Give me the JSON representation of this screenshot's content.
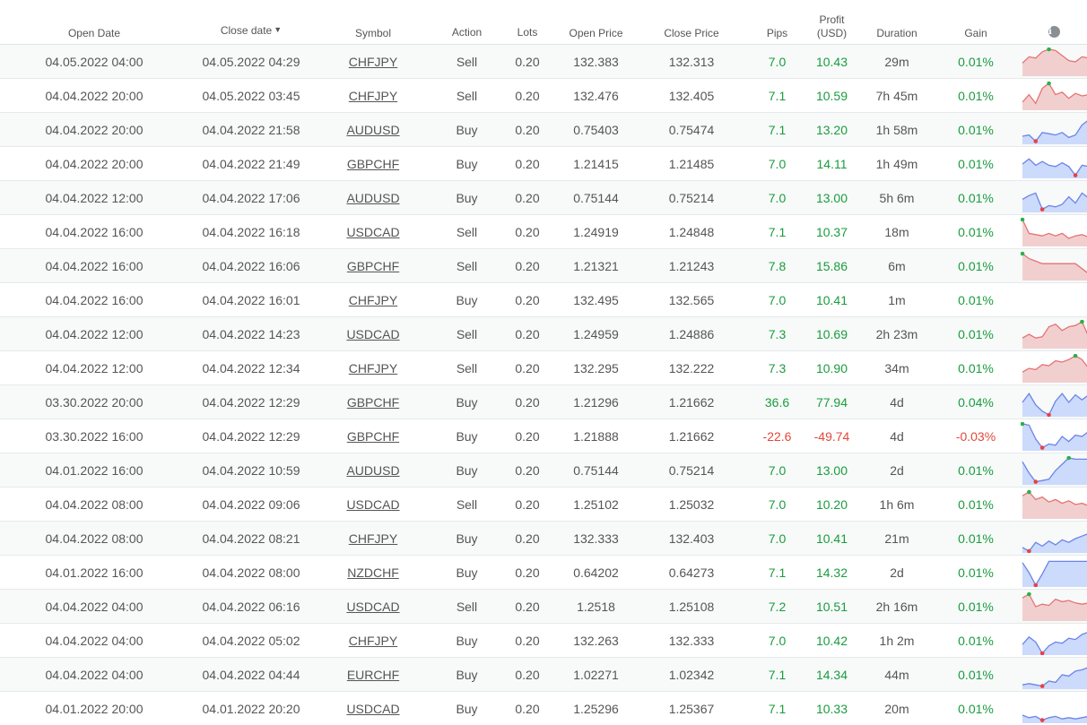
{
  "headers": {
    "open_date": "Open Date",
    "close_date": "Close date",
    "close_date_sort_indicator": "▼",
    "symbol": "Symbol",
    "action": "Action",
    "lots": "Lots",
    "open_price": "Open Price",
    "close_price": "Close Price",
    "pips": "Pips",
    "profit_line1": "Profit",
    "profit_line2": "(USD)",
    "duration": "Duration",
    "gain": "Gain",
    "info_icon": "info-icon"
  },
  "colors": {
    "positive": "#1a9c3e",
    "negative": "#e0483c",
    "sell_fill": "#f2cfcf",
    "sell_line": "#e57373",
    "buy_fill": "#ccdafc",
    "buy_line": "#6b84e8",
    "marker_high": "#2bb14a",
    "marker_low": "#ec4040"
  },
  "trades": [
    {
      "open_date": "04.05.2022 04:00",
      "close_date": "04.05.2022 04:29",
      "symbol": "CHFJPY",
      "action": "Sell",
      "lots": "0.20",
      "open_price": "132.383",
      "close_price": "132.313",
      "pips": "7.0",
      "profit": "10.43",
      "duration": "29m",
      "gain": "0.01%",
      "positive": true,
      "spark": [
        0.55,
        0.3,
        0.35,
        0.1,
        0.0,
        0.05,
        0.25,
        0.45,
        0.5,
        0.3,
        0.35,
        0.6,
        0.95,
        0.9
      ]
    },
    {
      "open_date": "04.04.2022 20:00",
      "close_date": "04.05.2022 03:45",
      "symbol": "CHFJPY",
      "action": "Sell",
      "lots": "0.20",
      "open_price": "132.476",
      "close_price": "132.405",
      "pips": "7.1",
      "profit": "10.59",
      "duration": "7h 45m",
      "gain": "0.01%",
      "positive": true,
      "spark": [
        0.75,
        0.45,
        0.8,
        0.2,
        0.0,
        0.45,
        0.35,
        0.6,
        0.4,
        0.5,
        0.45,
        0.5,
        0.95,
        0.75
      ]
    },
    {
      "open_date": "04.04.2022 20:00",
      "close_date": "04.04.2022 21:58",
      "symbol": "AUDUSD",
      "action": "Buy",
      "lots": "0.20",
      "open_price": "0.75403",
      "close_price": "0.75474",
      "pips": "7.1",
      "profit": "13.20",
      "duration": "1h 58m",
      "gain": "0.01%",
      "positive": true,
      "spark": [
        0.75,
        0.7,
        0.95,
        0.6,
        0.65,
        0.7,
        0.6,
        0.8,
        0.7,
        0.3,
        0.1,
        0.2,
        0.0,
        0.02
      ]
    },
    {
      "open_date": "04.04.2022 20:00",
      "close_date": "04.04.2022 21:49",
      "symbol": "GBPCHF",
      "action": "Buy",
      "lots": "0.20",
      "open_price": "1.21415",
      "close_price": "1.21485",
      "pips": "7.0",
      "profit": "14.11",
      "duration": "1h 49m",
      "gain": "0.01%",
      "positive": true,
      "spark": [
        0.5,
        0.3,
        0.55,
        0.4,
        0.55,
        0.6,
        0.45,
        0.6,
        0.95,
        0.55,
        0.6,
        0.2,
        0.1,
        0.0
      ]
    },
    {
      "open_date": "04.04.2022 12:00",
      "close_date": "04.04.2022 17:06",
      "symbol": "AUDUSD",
      "action": "Buy",
      "lots": "0.20",
      "open_price": "0.75144",
      "close_price": "0.75214",
      "pips": "7.0",
      "profit": "13.00",
      "duration": "5h 6m",
      "gain": "0.01%",
      "positive": true,
      "spark": [
        0.55,
        0.4,
        0.3,
        0.95,
        0.8,
        0.85,
        0.75,
        0.45,
        0.7,
        0.3,
        0.5,
        0.0,
        0.1,
        0.1
      ]
    },
    {
      "open_date": "04.04.2022 16:00",
      "close_date": "04.04.2022 16:18",
      "symbol": "USDCAD",
      "action": "Sell",
      "lots": "0.20",
      "open_price": "1.24919",
      "close_price": "1.24848",
      "pips": "7.1",
      "profit": "10.37",
      "duration": "18m",
      "gain": "0.01%",
      "positive": true,
      "spark": [
        0.0,
        0.55,
        0.6,
        0.65,
        0.55,
        0.65,
        0.55,
        0.75,
        0.65,
        0.6,
        0.7,
        0.75,
        0.95,
        0.85
      ]
    },
    {
      "open_date": "04.04.2022 16:00",
      "close_date": "04.04.2022 16:06",
      "symbol": "GBPCHF",
      "action": "Sell",
      "lots": "0.20",
      "open_price": "1.21321",
      "close_price": "1.21243",
      "pips": "7.8",
      "profit": "15.86",
      "duration": "6m",
      "gain": "0.01%",
      "positive": true,
      "spark": [
        0.0,
        0.2,
        0.3,
        0.4,
        0.4,
        0.4,
        0.4,
        0.4,
        0.4,
        0.6,
        0.8,
        0.95,
        0.85,
        0.65
      ]
    },
    {
      "open_date": "04.04.2022 16:00",
      "close_date": "04.04.2022 16:01",
      "symbol": "CHFJPY",
      "action": "Buy",
      "lots": "0.20",
      "open_price": "132.495",
      "close_price": "132.565",
      "pips": "7.0",
      "profit": "10.41",
      "duration": "1m",
      "gain": "0.01%",
      "positive": true,
      "spark": null
    },
    {
      "open_date": "04.04.2022 12:00",
      "close_date": "04.04.2022 14:23",
      "symbol": "USDCAD",
      "action": "Sell",
      "lots": "0.20",
      "open_price": "1.24959",
      "close_price": "1.24886",
      "pips": "7.3",
      "profit": "10.69",
      "duration": "2h 23m",
      "gain": "0.01%",
      "positive": true,
      "spark": [
        0.65,
        0.5,
        0.65,
        0.6,
        0.2,
        0.1,
        0.35,
        0.2,
        0.15,
        0.0,
        0.6,
        0.85,
        0.95,
        0.95
      ]
    },
    {
      "open_date": "04.04.2022 12:00",
      "close_date": "04.04.2022 12:34",
      "symbol": "CHFJPY",
      "action": "Sell",
      "lots": "0.20",
      "open_price": "132.295",
      "close_price": "132.222",
      "pips": "7.3",
      "profit": "10.90",
      "duration": "34m",
      "gain": "0.01%",
      "positive": true,
      "spark": [
        0.65,
        0.5,
        0.55,
        0.35,
        0.4,
        0.2,
        0.25,
        0.15,
        0.0,
        0.15,
        0.5,
        0.7,
        0.95,
        0.85
      ]
    },
    {
      "open_date": "03.30.2022 20:00",
      "close_date": "04.04.2022 12:29",
      "symbol": "GBPCHF",
      "action": "Buy",
      "lots": "0.20",
      "open_price": "1.21296",
      "close_price": "1.21662",
      "pips": "36.6",
      "profit": "77.94",
      "duration": "4d",
      "gain": "0.04%",
      "positive": true,
      "spark": [
        0.5,
        0.15,
        0.6,
        0.85,
        1.0,
        0.45,
        0.15,
        0.5,
        0.2,
        0.4,
        0.2,
        0.25,
        0.2,
        0.0
      ]
    },
    {
      "open_date": "03.30.2022 16:00",
      "close_date": "04.04.2022 12:29",
      "symbol": "GBPCHF",
      "action": "Buy",
      "lots": "0.20",
      "open_price": "1.21888",
      "close_price": "1.21662",
      "pips": "-22.6",
      "profit": "-49.74",
      "duration": "4d",
      "gain": "-0.03%",
      "positive": false,
      "spark": [
        0.0,
        0.05,
        0.6,
        0.95,
        0.8,
        0.85,
        0.5,
        0.7,
        0.45,
        0.5,
        0.3,
        0.35,
        0.35,
        0.3
      ]
    },
    {
      "open_date": "04.01.2022 16:00",
      "close_date": "04.04.2022 10:59",
      "symbol": "AUDUSD",
      "action": "Buy",
      "lots": "0.20",
      "open_price": "0.75144",
      "close_price": "0.75214",
      "pips": "7.0",
      "profit": "13.00",
      "duration": "2d",
      "gain": "0.01%",
      "positive": true,
      "spark": [
        0.15,
        0.6,
        0.95,
        0.9,
        0.85,
        0.5,
        0.25,
        0.0,
        0.05,
        0.05,
        0.05,
        0.0,
        0.0,
        0.0
      ]
    },
    {
      "open_date": "04.04.2022 08:00",
      "close_date": "04.04.2022 09:06",
      "symbol": "USDCAD",
      "action": "Sell",
      "lots": "0.20",
      "open_price": "1.25102",
      "close_price": "1.25032",
      "pips": "7.0",
      "profit": "10.20",
      "duration": "1h 6m",
      "gain": "0.01%",
      "positive": true,
      "spark": [
        0.15,
        0.0,
        0.3,
        0.2,
        0.4,
        0.3,
        0.45,
        0.35,
        0.5,
        0.45,
        0.55,
        0.5,
        0.95,
        0.95
      ]
    },
    {
      "open_date": "04.04.2022 08:00",
      "close_date": "04.04.2022 08:21",
      "symbol": "CHFJPY",
      "action": "Buy",
      "lots": "0.20",
      "open_price": "132.333",
      "close_price": "132.403",
      "pips": "7.0",
      "profit": "10.41",
      "duration": "21m",
      "gain": "0.01%",
      "positive": true,
      "spark": [
        0.85,
        1.0,
        0.65,
        0.8,
        0.6,
        0.75,
        0.55,
        0.65,
        0.5,
        0.4,
        0.3,
        0.2,
        0.1,
        0.0
      ]
    },
    {
      "open_date": "04.01.2022 16:00",
      "close_date": "04.04.2022 08:00",
      "symbol": "NZDCHF",
      "action": "Buy",
      "lots": "0.20",
      "open_price": "0.64202",
      "close_price": "0.64273",
      "pips": "7.1",
      "profit": "14.32",
      "duration": "2d",
      "gain": "0.01%",
      "positive": true,
      "spark": [
        0.1,
        0.5,
        1.0,
        0.55,
        0.05,
        0.05,
        0.05,
        0.05,
        0.05,
        0.05,
        0.05,
        0.0,
        0.0,
        0.0
      ]
    },
    {
      "open_date": "04.04.2022 04:00",
      "close_date": "04.04.2022 06:16",
      "symbol": "USDCAD",
      "action": "Sell",
      "lots": "0.20",
      "open_price": "1.2518",
      "close_price": "1.25108",
      "pips": "7.2",
      "profit": "10.51",
      "duration": "2h 16m",
      "gain": "0.01%",
      "positive": true,
      "spark": [
        0.15,
        0.0,
        0.5,
        0.4,
        0.45,
        0.2,
        0.3,
        0.25,
        0.35,
        0.4,
        0.35,
        0.95,
        0.95,
        0.9
      ]
    },
    {
      "open_date": "04.04.2022 04:00",
      "close_date": "04.04.2022 05:02",
      "symbol": "CHFJPY",
      "action": "Buy",
      "lots": "0.20",
      "open_price": "132.263",
      "close_price": "132.333",
      "pips": "7.0",
      "profit": "10.42",
      "duration": "1h 2m",
      "gain": "0.01%",
      "positive": true,
      "spark": [
        0.65,
        0.35,
        0.55,
        1.0,
        0.7,
        0.55,
        0.6,
        0.4,
        0.45,
        0.25,
        0.15,
        0.1,
        0.0,
        0.05
      ]
    },
    {
      "open_date": "04.04.2022 04:00",
      "close_date": "04.04.2022 04:44",
      "symbol": "EURCHF",
      "action": "Buy",
      "lots": "0.20",
      "open_price": "1.02271",
      "close_price": "1.02342",
      "pips": "7.1",
      "profit": "14.34",
      "duration": "44m",
      "gain": "0.01%",
      "positive": true,
      "spark": [
        0.9,
        0.85,
        0.9,
        0.95,
        0.75,
        0.8,
        0.5,
        0.55,
        0.35,
        0.3,
        0.2,
        0.15,
        0.0,
        0.1
      ]
    },
    {
      "open_date": "04.01.2022 20:00",
      "close_date": "04.01.2022 20:20",
      "symbol": "USDCAD",
      "action": "Buy",
      "lots": "0.20",
      "open_price": "1.25296",
      "close_price": "1.25367",
      "pips": "7.1",
      "profit": "10.33",
      "duration": "20m",
      "gain": "0.01%",
      "positive": true,
      "spark": [
        0.75,
        0.85,
        0.8,
        0.95,
        0.85,
        0.8,
        0.9,
        0.85,
        0.9,
        0.85,
        0.8,
        0.55,
        0.05,
        0.0
      ]
    }
  ]
}
